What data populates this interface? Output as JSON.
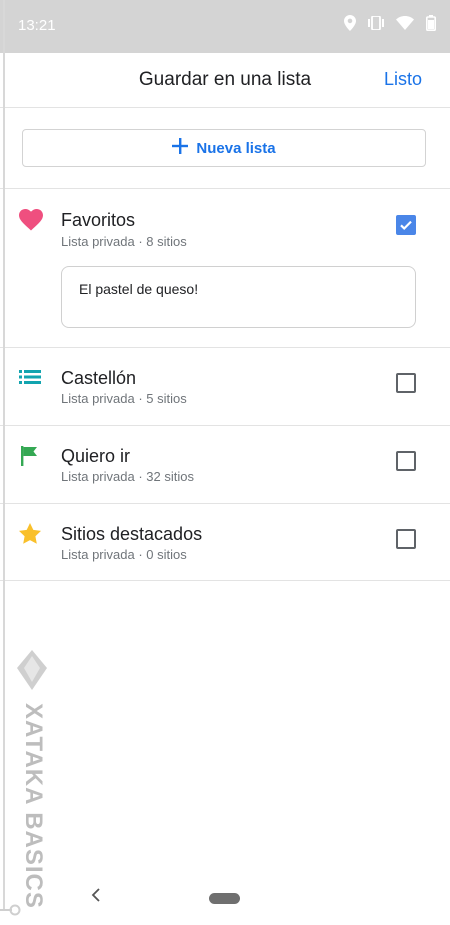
{
  "status": {
    "time": "13:21"
  },
  "header": {
    "title": "Guardar en una lista",
    "done_label": "Listo"
  },
  "new_list": {
    "label": "Nueva lista"
  },
  "lists": [
    {
      "title": "Favoritos",
      "subtitle": "Lista privada · 8 sitios",
      "icon": "heart-icon",
      "icon_color": "#ef4f7f",
      "checked": true,
      "note": "El pastel de queso!"
    },
    {
      "title": "Castellón",
      "subtitle": "Lista privada · 5 sitios",
      "icon": "list-icon",
      "icon_color": "#12a4af",
      "checked": false
    },
    {
      "title": "Quiero ir",
      "subtitle": "Lista privada · 32 sitios",
      "icon": "flag-icon",
      "icon_color": "#34a853",
      "checked": false
    },
    {
      "title": "Sitios destacados",
      "subtitle": "Lista privada · 0 sitios",
      "icon": "star-icon",
      "icon_color": "#f9c02b",
      "checked": false
    }
  ],
  "watermark": {
    "text": "XATAKA BASICS"
  },
  "colors": {
    "accent": "#1a73e8",
    "checkbox_checked": "#4a86e8",
    "status_bar": "#d4d4d4"
  }
}
